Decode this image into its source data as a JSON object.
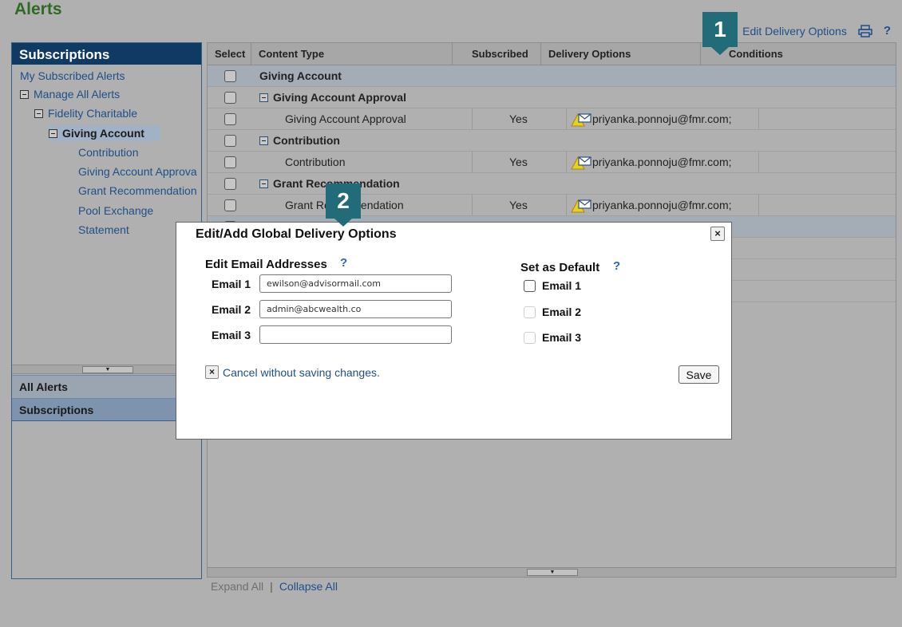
{
  "page": {
    "title": "Alerts",
    "edit_delivery_label": "Edit Delivery Options",
    "help_label": "?",
    "print_icon": "printer-icon"
  },
  "sidebar": {
    "header": "Subscriptions",
    "items": [
      {
        "label": "My Subscribed Alerts"
      },
      {
        "label": "Manage All Alerts"
      },
      {
        "label": "Fidelity Charitable"
      },
      {
        "label": "Giving Account"
      },
      {
        "label": "Contribution"
      },
      {
        "label": "Giving Account Approva"
      },
      {
        "label": "Grant Recommendation"
      },
      {
        "label": "Pool Exchange"
      },
      {
        "label": "Statement"
      }
    ],
    "accordion": [
      {
        "label": "All Alerts"
      },
      {
        "label": "Subscriptions"
      }
    ]
  },
  "grid": {
    "columns": [
      "Select",
      "Content Type",
      "Subscribed",
      "Delivery Options",
      "Conditions"
    ],
    "rows": [
      {
        "content": "Giving Account",
        "subscribed": "",
        "delivery": ""
      },
      {
        "content": "Giving Account Approval",
        "subscribed": "",
        "delivery": ""
      },
      {
        "content": "Giving Account Approval",
        "subscribed": "Yes",
        "delivery": "priyanka.ponnoju@fmr.com;"
      },
      {
        "content": "Contribution",
        "subscribed": "",
        "delivery": ""
      },
      {
        "content": "Contribution",
        "subscribed": "Yes",
        "delivery": "priyanka.ponnoju@fmr.com;"
      },
      {
        "content": "Grant Recommendation",
        "subscribed": "",
        "delivery": ""
      },
      {
        "content": "Grant Recommendation",
        "subscribed": "Yes",
        "delivery": "priyanka.ponnoju@fmr.com;"
      }
    ],
    "expand_all": "Expand All",
    "separator": "|",
    "collapse_all": "Collapse All"
  },
  "callouts": [
    "1",
    "2"
  ],
  "modal": {
    "title": "Edit/Add Global Delivery Options",
    "close_label": "×",
    "email_section_title": "Edit Email Addresses",
    "default_section_title": "Set as Default",
    "help_label": "?",
    "emails": [
      {
        "label": "Email 1",
        "value": "ewilson@advisormail.com"
      },
      {
        "label": "Email 2",
        "value": "admin@abcwealth.co"
      },
      {
        "label": "Email 3",
        "value": ""
      }
    ],
    "defaults": [
      {
        "label": "Email 1",
        "enabled": true
      },
      {
        "label": "Email 2",
        "enabled": false
      },
      {
        "label": "Email 3",
        "enabled": false
      }
    ],
    "cancel_label": "Cancel without saving changes.",
    "cancel_icon": "×",
    "save_label": "Save"
  }
}
